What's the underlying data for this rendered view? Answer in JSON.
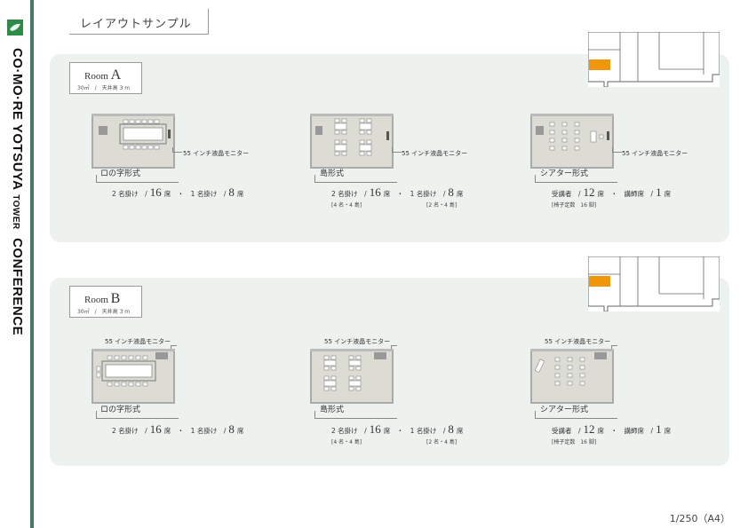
{
  "sidebar": {
    "title_main": "CO·MO·RE YOTSUYA",
    "title_small": "TOWER",
    "title_end": "CONFERENCE",
    "logo": "comore-leaf-logo"
  },
  "header": {
    "title": "レイアウトサンプル"
  },
  "rooms": [
    {
      "name": "Room",
      "letter": "A",
      "area": "30㎡　/　天井高 3 m",
      "layouts": [
        {
          "facility": "55 インチ液晶モニター",
          "name": "ロの字形式",
          "cap_a_label": "2 名掛け　/",
          "cap_a_value": "16",
          "cap_a_unit": "席　・　1 名掛け　/",
          "cap_b_value": "8",
          "cap_b_unit": "席",
          "note_a": "",
          "note_b": ""
        },
        {
          "facility": "55 インチ液晶モニター",
          "name": "島形式",
          "cap_a_label": "2 名掛け　/",
          "cap_a_value": "16",
          "cap_a_unit": "席　・　1 名掛け　/",
          "cap_b_value": "8",
          "cap_b_unit": "席",
          "note_a": "[4 名・4 島]",
          "note_b": "[2 名・4 島]"
        },
        {
          "facility": "55 インチ液晶モニター",
          "name": "シアター形式",
          "cap_a_label": "受講者　/",
          "cap_a_value": "12",
          "cap_a_unit": "席　・　講師席　/",
          "cap_b_value": "1",
          "cap_b_unit": "席",
          "note_a": "[椅子定数　16 脚]",
          "note_b": ""
        }
      ]
    },
    {
      "name": "Room",
      "letter": "B",
      "area": "30㎡　/　天井高 3 m",
      "layouts": [
        {
          "facility": "55 インチ液晶モニター",
          "name": "ロの字形式",
          "cap_a_label": "2 名掛け　/",
          "cap_a_value": "16",
          "cap_a_unit": "席　・　1 名掛け　/",
          "cap_b_value": "8",
          "cap_b_unit": "席",
          "note_a": "",
          "note_b": ""
        },
        {
          "facility": "55 インチ液晶モニター",
          "name": "島形式",
          "cap_a_label": "2 名掛け　/",
          "cap_a_value": "16",
          "cap_a_unit": "席　・　1 名掛け　/",
          "cap_b_value": "8",
          "cap_b_unit": "席",
          "note_a": "[4 名・4 島]",
          "note_b": "[2 名・4 島]"
        },
        {
          "facility": "55 インチ液晶モニター",
          "name": "シアター形式",
          "cap_a_label": "受講者　/",
          "cap_a_value": "12",
          "cap_a_unit": "席　・　講師席　/",
          "cap_b_value": "1",
          "cap_b_unit": "席",
          "note_a": "[椅子定数　16 脚]",
          "note_b": ""
        }
      ]
    }
  ],
  "footer": {
    "page": "1/250（A4）"
  },
  "colors": {
    "accent": "#4a7868",
    "highlight": "#f0960a",
    "panel": "#edf2ef"
  }
}
